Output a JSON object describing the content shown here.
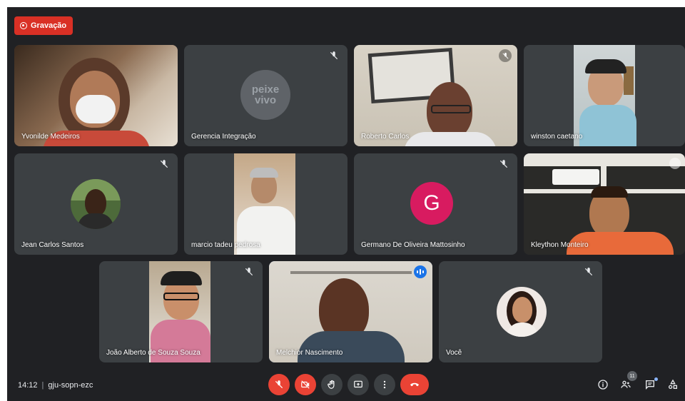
{
  "recording": {
    "label": "Gravação"
  },
  "participants": [
    {
      "name": "Yvonilde Medeiros"
    },
    {
      "name": "Gerencia Integração",
      "logo_text": "peixe vivo"
    },
    {
      "name": "Roberto Carlos"
    },
    {
      "name": "winston caetano"
    },
    {
      "name": "Jean Carlos Santos"
    },
    {
      "name": "marcio tadeu pedrosa"
    },
    {
      "name": "Germano De Oliveira Mattosinho",
      "avatar_letter": "G"
    },
    {
      "name": "Kleython Monteiro"
    },
    {
      "name": "João Alberto de Souza Souza"
    },
    {
      "name": "Melchior Nascimento"
    },
    {
      "name": "Você"
    }
  ],
  "bottom_bar": {
    "time": "14:12",
    "separator": "|",
    "meeting_code": "gju-sopn-ezc",
    "participant_count": "11"
  },
  "colors": {
    "background": "#202124",
    "tile": "#3c4043",
    "danger": "#ea4335",
    "active_speaker": "#8ab4f8"
  },
  "icons": [
    "record-icon",
    "mic-off-icon",
    "camera-off-icon",
    "raise-hand-icon",
    "present-icon",
    "more-icon",
    "end-call-icon",
    "info-icon",
    "people-icon",
    "chat-icon",
    "activities-icon"
  ]
}
